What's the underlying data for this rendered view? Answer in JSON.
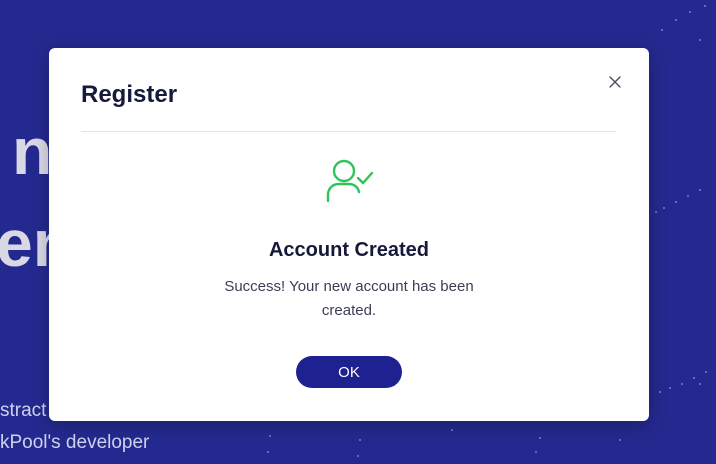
{
  "background": {
    "heading_line1": "n",
    "heading_line2": "en",
    "text_line1": "stract g",
    "text_line2": "kPool's developer"
  },
  "modal": {
    "title": "Register",
    "close_icon": "close-icon",
    "success_icon": "user-check-icon",
    "success_title": "Account Created",
    "success_message": "Success! Your new account has been created.",
    "ok_label": "OK"
  },
  "colors": {
    "background": "#24298f",
    "accent": "#1e2190",
    "success": "#2ec45a",
    "title_text": "#16193a"
  }
}
